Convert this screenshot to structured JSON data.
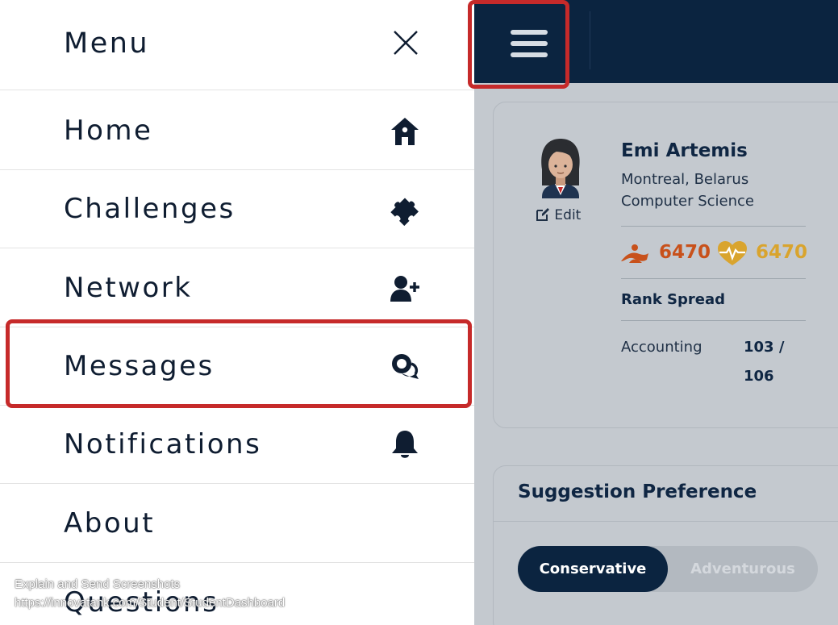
{
  "menu": {
    "title": "Menu",
    "items": [
      {
        "label": "Home",
        "icon": "home-icon"
      },
      {
        "label": "Challenges",
        "icon": "puzzle-icon"
      },
      {
        "label": "Network",
        "icon": "user-plus-icon"
      },
      {
        "label": "Messages",
        "icon": "chat-icon"
      },
      {
        "label": "Notifications",
        "icon": "bell-icon"
      },
      {
        "label": "About",
        "icon": ""
      },
      {
        "label": "Questions",
        "icon": ""
      }
    ]
  },
  "watermark": {
    "line1": "Explain and Send Screenshots",
    "line2": "https://innovatank.com/Student/StudentDashboard"
  },
  "profile": {
    "name": "Emi Artemis",
    "location": "Montreal, Belarus",
    "field": "Computer Science",
    "edit_label": "Edit",
    "stat1": "6470",
    "stat2": "6470",
    "rank_heading": "Rank Spread",
    "rank_subject": "Accounting",
    "rank_value_line1": "103 /",
    "rank_value_line2": "106"
  },
  "preference": {
    "title": "Suggestion Preference",
    "option_selected": "Conservative",
    "option_other": "Adventurous"
  },
  "colors": {
    "navy": "#0b2440",
    "highlight_red": "#c62a2a",
    "stat1_orange": "#c8511b",
    "stat2_gold": "#d9a42e"
  }
}
